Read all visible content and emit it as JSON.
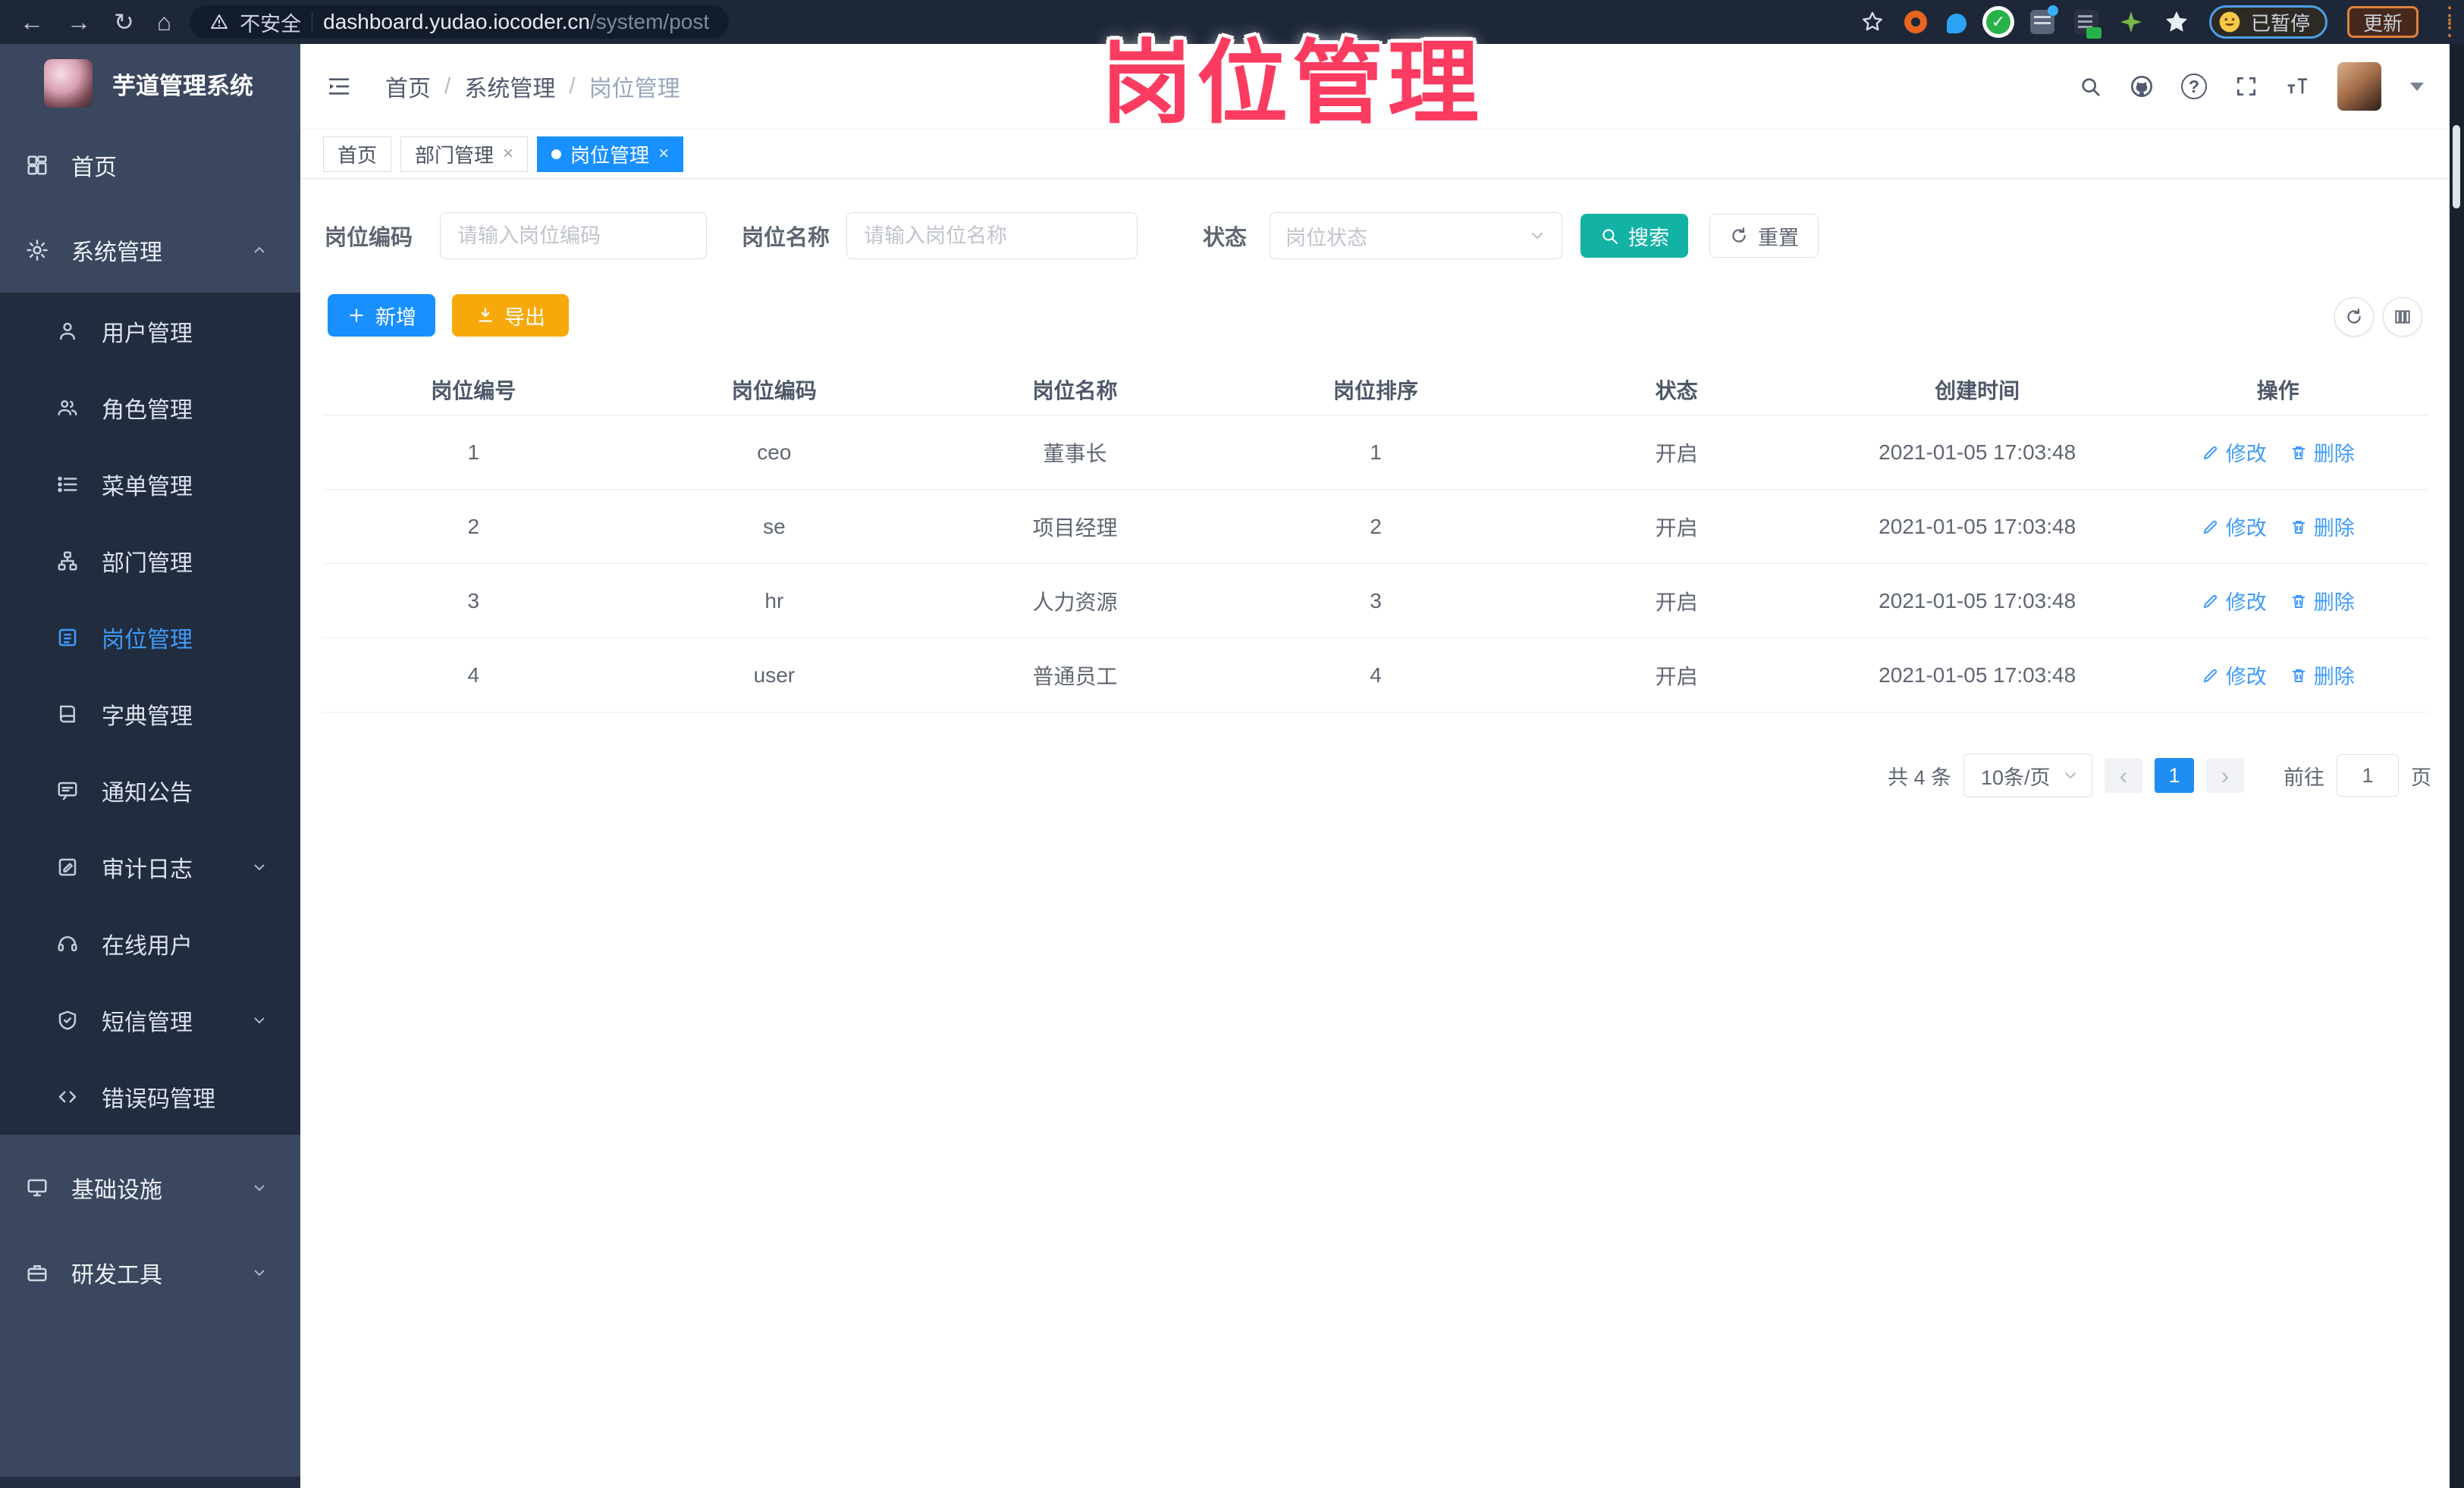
{
  "browser": {
    "security_label": "不安全",
    "url_host": "dashboard.yudao.iocoder.cn",
    "url_path": "/system/post",
    "paused_label": "已暂停",
    "update_label": "更新"
  },
  "overlay": {
    "title": "岗位管理"
  },
  "sidebar": {
    "app_title": "芋道管理系统",
    "items": [
      {
        "label": "首页"
      },
      {
        "label": "系统管理"
      },
      {
        "label": "用户管理"
      },
      {
        "label": "角色管理"
      },
      {
        "label": "菜单管理"
      },
      {
        "label": "部门管理"
      },
      {
        "label": "岗位管理"
      },
      {
        "label": "字典管理"
      },
      {
        "label": "通知公告"
      },
      {
        "label": "审计日志"
      },
      {
        "label": "在线用户"
      },
      {
        "label": "短信管理"
      },
      {
        "label": "错误码管理"
      },
      {
        "label": "基础设施"
      },
      {
        "label": "研发工具"
      }
    ]
  },
  "breadcrumb": {
    "separator": "/",
    "items": [
      "首页",
      "系统管理",
      "岗位管理"
    ]
  },
  "tabs": [
    {
      "label": "首页"
    },
    {
      "label": "部门管理"
    },
    {
      "label": "岗位管理"
    }
  ],
  "filters": {
    "code_label": "岗位编码",
    "code_placeholder": "请输入岗位编码",
    "name_label": "岗位名称",
    "name_placeholder": "请输入岗位名称",
    "status_label": "状态",
    "status_placeholder": "岗位状态",
    "search_label": "搜索",
    "reset_label": "重置"
  },
  "toolbar": {
    "add_label": "新增",
    "export_label": "导出"
  },
  "table": {
    "headers": [
      "岗位编号",
      "岗位编码",
      "岗位名称",
      "岗位排序",
      "状态",
      "创建时间",
      "操作"
    ],
    "edit_label": "修改",
    "delete_label": "删除",
    "rows": [
      {
        "id": "1",
        "code": "ceo",
        "name": "董事长",
        "sort": "1",
        "status": "开启",
        "created": "2021-01-05 17:03:48"
      },
      {
        "id": "2",
        "code": "se",
        "name": "项目经理",
        "sort": "2",
        "status": "开启",
        "created": "2021-01-05 17:03:48"
      },
      {
        "id": "3",
        "code": "hr",
        "name": "人力资源",
        "sort": "3",
        "status": "开启",
        "created": "2021-01-05 17:03:48"
      },
      {
        "id": "4",
        "code": "user",
        "name": "普通员工",
        "sort": "4",
        "status": "开启",
        "created": "2021-01-05 17:03:48"
      }
    ]
  },
  "pagination": {
    "total_label": "共 4 条",
    "page_size": "10条/页",
    "prev": "‹",
    "next": "›",
    "current_page": "1",
    "goto_label": "前往",
    "goto_value": "1",
    "page_unit": "页"
  },
  "colors": {
    "accent_blue": "#1890ff",
    "search_teal": "#12b2a5",
    "export_orange": "#f7a90a",
    "overlay_pink": "#fb3b5f",
    "active_menu": "#3f9bfa"
  }
}
